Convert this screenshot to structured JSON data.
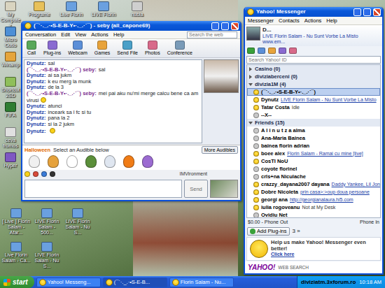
{
  "desktop": {
    "icons": [
      {
        "label": "My Computer"
      },
      {
        "label": "Programe"
      },
      {
        "label": "Live Florin"
      },
      {
        "label": "LIVE Florin"
      },
      {
        "label": "nubia"
      },
      {
        "label": "Micro Outlo"
      },
      {
        "label": "Winamp"
      },
      {
        "label": "Shortcut 2SD"
      },
      {
        "label": "FIFA"
      },
      {
        "label": "ceva frumos"
      },
      {
        "label": "Hyper"
      },
      {
        "label": "[ Live ] Florin Salam - Afar..."
      },
      {
        "label": "LIVE Florin Salam - 500..."
      },
      {
        "label": "LIVE Florin Salam - Nu S..."
      },
      {
        "label": "Live Florin Salam - Ca..."
      },
      {
        "label": "LIVE Florin Salam - Nu S..."
      }
    ]
  },
  "chat": {
    "title": "(¯`·._.·•S-E-B-Y•·._.·´¯) - seby (all_capone69)",
    "menu": [
      "Conversation",
      "Edit",
      "View",
      "Actions",
      "Help"
    ],
    "search": {
      "placeholder": "Search the web"
    },
    "toolbar": [
      "Call",
      "Plug-ins",
      "Webcam",
      "Games",
      "Send File",
      "Photos",
      "Conference"
    ],
    "messages": [
      {
        "sender": "Dynutz:",
        "text": "sal",
        "own": false,
        "emoticon": false
      },
      {
        "sender": "(¯`·._.·•S-E-B-Y•·._.·´¯) seby:",
        "text": "sal",
        "own": true,
        "emoticon": false
      },
      {
        "sender": "Dynutz:",
        "text": "ai sa jukm",
        "own": false,
        "emoticon": false
      },
      {
        "sender": "Dynutz:",
        "text": "k eu merg la munk",
        "own": false,
        "emoticon": false
      },
      {
        "sender": "Dynutz:",
        "text": "de la 3",
        "own": false,
        "emoticon": false
      },
      {
        "sender": "(¯`·._.·•S-E-B-Y•·._.·´¯) seby:",
        "text": "mei pai aku nu'mi merge calcu bene ca am virusi",
        "own": true,
        "emoticon": true
      },
      {
        "sender": "Dynutz:",
        "text": "atunci",
        "own": false,
        "emoticon": false
      },
      {
        "sender": "Dynutz:",
        "text": "inceark sa l fc si tu",
        "own": false,
        "emoticon": false
      },
      {
        "sender": "Dynutz:",
        "text": "pana la 2",
        "own": false,
        "emoticon": false
      },
      {
        "sender": "Dynutz:",
        "text": "si la 2 jukm",
        "own": false,
        "emoticon": false
      },
      {
        "sender": "Dynutz:",
        "own": false,
        "emoticon": true
      }
    ],
    "audibles": {
      "title": "Halloween",
      "prompt": "Select an Audible below",
      "more": "More Audibles"
    },
    "imvironment": "IMVironment",
    "send": "Send"
  },
  "messenger": {
    "title": "Yahoo! Messenger",
    "menu": [
      "Messenger",
      "Contacts",
      "Actions",
      "Help"
    ],
    "me": {
      "name": "D...",
      "status": "LIVE Florin Salam - Nu Sunt Vorbe La Misto www.em..."
    },
    "search": {
      "placeholder": "Search Yahoo! ID"
    },
    "groups": [
      {
        "label": "Casino (0)",
        "expanded": false,
        "contacts": []
      },
      {
        "label": "diviziaberceni (0)",
        "expanded": false,
        "contacts": []
      },
      {
        "label": "divizia1M (4)",
        "expanded": true,
        "contacts": [
          {
            "name": "(¯`·._.·•S-E-B-Y•·._.·´¯)",
            "online": true,
            "selected": true
          },
          {
            "name": "Dynutz",
            "status": "LIVE Florin Salam - Nu Sunt Vorbe La Misto",
            "link": true,
            "online": true,
            "selected": false
          },
          {
            "name": "Tatar Costa",
            "status": "Idle",
            "link": false,
            "online": true,
            "selected": false
          },
          {
            "name": "--X--",
            "online": false,
            "selected": false
          }
        ]
      },
      {
        "label": "Friends (15)",
        "expanded": true,
        "contacts": [
          {
            "name": "A l i n u t z a alma",
            "online": false,
            "selected": false
          },
          {
            "name": "Ana-Maria Bainea",
            "online": false,
            "selected": false
          },
          {
            "name": "bainea florin adrian",
            "online": false,
            "selected": false
          },
          {
            "name": "boee alex",
            "status": "Florin Salam - Ramai cu mine [live]",
            "link": true,
            "online": true,
            "selected": false
          },
          {
            "name": "CosTI NoU",
            "online": true,
            "selected": false
          },
          {
            "name": "coyote florinel",
            "online": false,
            "selected": false
          },
          {
            "name": "crls+na Niculache",
            "online": false,
            "selected": false
          },
          {
            "name": "crazzy_dayana2007 dayana",
            "status": "Daddy Yankee, Lil Jon",
            "link": true,
            "online": true,
            "selected": false
          },
          {
            "name": "Dobre Nicoleta",
            "status": "prin casa>:>oup doua persoane",
            "link": true,
            "online": true,
            "selected": false
          },
          {
            "name": "georgi ana",
            "status": "http://georgianalaura.hi5.com",
            "link": true,
            "online": true,
            "selected": false
          },
          {
            "name": "iulia rogoveanu",
            "status": "Not at My Desk",
            "link": false,
            "online": true,
            "selected": false
          },
          {
            "name": "Ovidiu Net",
            "online": false,
            "selected": false
          }
        ]
      }
    ],
    "phone": {
      "out": "$0.00 - Phone Out",
      "in": "Phone In"
    },
    "plugins": {
      "label": "Add Plug-ins",
      "page": "3 »"
    },
    "ad": {
      "text": "Help us make Yahoo! Messenger even better!",
      "link": "Click here"
    },
    "footer": {
      "brand": "YAHOO!",
      "sub": "WEB SEARCH"
    }
  },
  "taskbar": {
    "start": "start",
    "items": [
      {
        "label": "Yahoo! Messeng...",
        "selected": false
      },
      {
        "label": "(¯`·._.·•S-E-B...",
        "selected": true
      },
      {
        "label": "Florin Salam - Nu...",
        "selected": false
      }
    ],
    "watermark": "diviziatm.3xforum.ro",
    "clock": "10:18 AM"
  }
}
